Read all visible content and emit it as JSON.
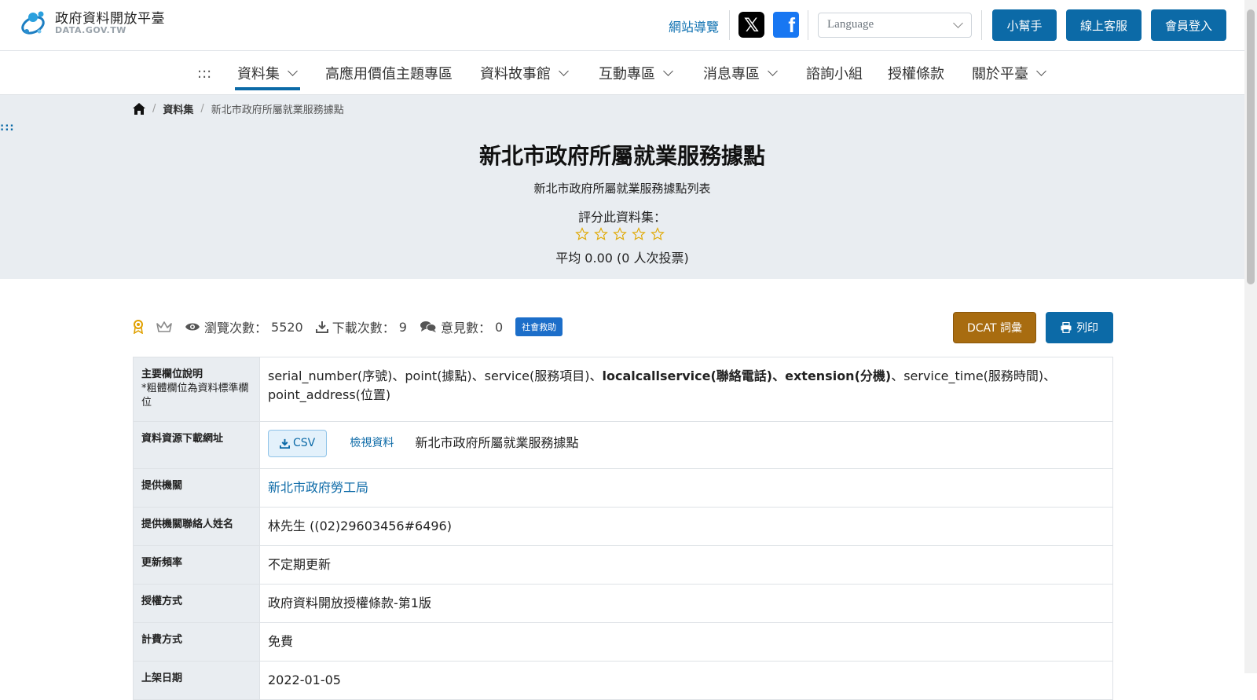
{
  "header": {
    "logo_zh": "政府資料開放平臺",
    "logo_en": "DATA.GOV.TW",
    "sitemap": "網站導覽",
    "language_placeholder": "Language",
    "helper_btn": "小幫手",
    "service_btn": "線上客服",
    "login_btn": "會員登入",
    "social": {
      "x_icon": "x-logo-icon",
      "fb_icon": "facebook-icon"
    }
  },
  "nav": {
    "skip": ":::",
    "items": [
      {
        "label": "資料集",
        "has_menu": true,
        "active": true
      },
      {
        "label": "高應用價值主題專區",
        "has_menu": false
      },
      {
        "label": "資料故事館",
        "has_menu": true
      },
      {
        "label": "互動專區",
        "has_menu": true
      },
      {
        "label": "消息專區",
        "has_menu": true
      },
      {
        "label": "諮詢小組",
        "has_menu": false
      },
      {
        "label": "授權條款",
        "has_menu": false
      },
      {
        "label": "關於平臺",
        "has_menu": true
      }
    ]
  },
  "breadcrumb": {
    "items": [
      "資料集",
      "新北市政府所屬就業服務據點"
    ]
  },
  "skip_dots": ":::",
  "dataset": {
    "title": "新北市政府所屬就業服務據點",
    "description": "新北市政府所屬就業服務據點列表",
    "rate_label": "評分此資料集：",
    "average": "平均 0.00 (0 人次投票)"
  },
  "stats": {
    "views_label": "瀏覽次數：",
    "views": "5520",
    "downloads_label": "下載次數：",
    "downloads": "9",
    "comments_label": "意見數：",
    "comments": "0",
    "category_tag": "社會救助",
    "dcat_btn": "DCAT 詞彙",
    "print_btn": "列印"
  },
  "info": {
    "fields_key": "主要欄位說明",
    "fields_note": "*粗體欄位為資料標準欄位",
    "fields_plain_1": "serial_number(序號)、point(據點)、service(服務項目)、",
    "fields_bold": "localcallservice(聯絡電話)、extension(分機)",
    "fields_plain_2": "、service_time(服務時間)、point_address(位置)",
    "resource_key": "資料資源下載網址",
    "csv_label": "CSV",
    "view_label": "檢視資料",
    "resource_name": "新北市政府所屬就業服務據點",
    "org_key": "提供機關",
    "org_value": "新北市政府勞工局",
    "contact_key": "提供機關聯絡人姓名",
    "contact_value": "林先生 ((02)29603456#6496)",
    "freq_key": "更新頻率",
    "freq_value": "不定期更新",
    "license_key": "授權方式",
    "license_value": "政府資料開放授權條款-第1版",
    "fee_key": "計費方式",
    "fee_value": "免費",
    "publish_key": "上架日期",
    "publish_value": "2022-01-05"
  },
  "colors": {
    "primary": "#0c6aa7",
    "dcat": "#a86c10",
    "hero_bg": "#e9edf1",
    "tag": "#1c6ec9"
  }
}
